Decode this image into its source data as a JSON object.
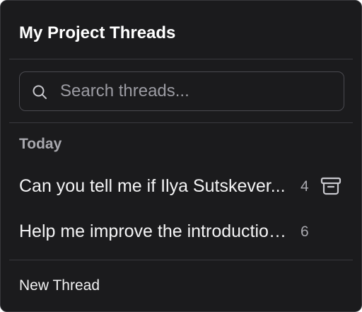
{
  "header": {
    "title": "My Project Threads"
  },
  "search": {
    "placeholder": "Search threads...",
    "icon": "search-icon"
  },
  "sections": [
    {
      "label": "Today",
      "threads": [
        {
          "title": "Can you tell me if Ilya Sutskever...",
          "count": "4",
          "action_icon": "archive-icon"
        },
        {
          "title": "Help me improve the introduction...",
          "count": "6"
        }
      ]
    }
  ],
  "footer": {
    "new_thread_label": "New Thread"
  },
  "colors": {
    "panel_background": "#1b1b1d",
    "border": "#38383c",
    "muted_text": "#a8a8ae",
    "text": "#f2f2f3"
  }
}
